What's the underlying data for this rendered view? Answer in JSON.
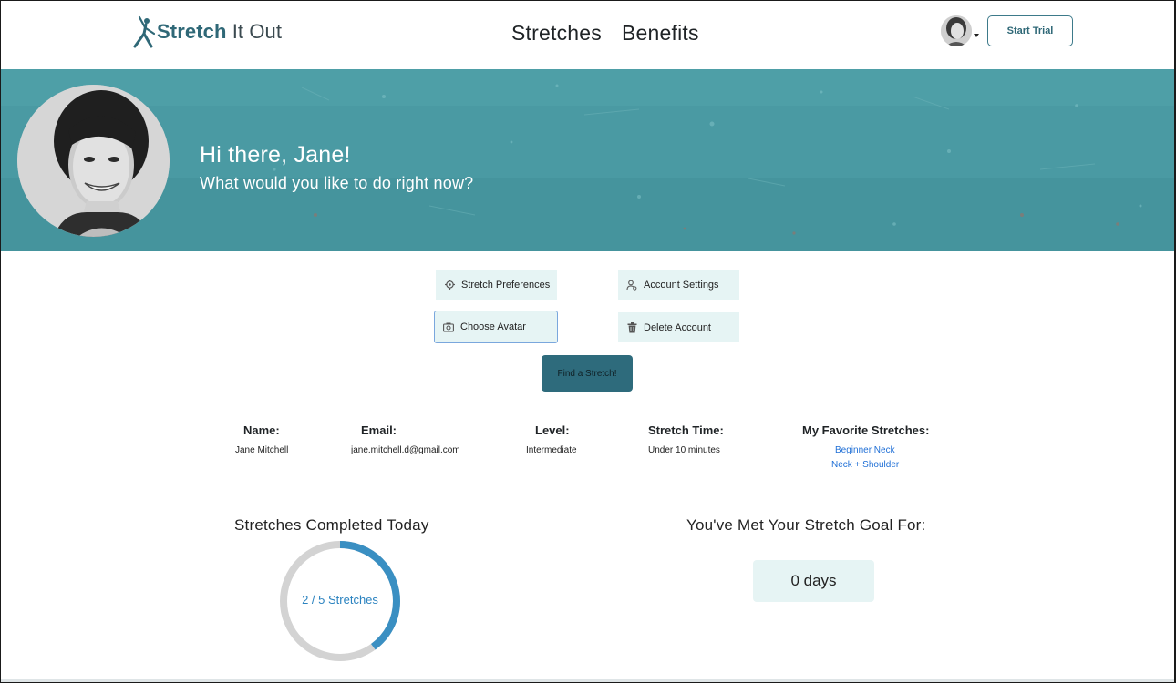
{
  "header": {
    "logo_bold": "Stretch",
    "logo_rest": " It Out",
    "nav": [
      "Stretches",
      "Benefits"
    ],
    "start_trial": "Start Trial"
  },
  "banner": {
    "greeting": "Hi there, Jane!",
    "subtitle": "What would you like to do right now?"
  },
  "actions": {
    "stretch_preferences": "Stretch Preferences",
    "account_settings": "Account Settings",
    "choose_avatar": "Choose Avatar",
    "delete_account": "Delete Account",
    "find_stretch": "Find a Stretch!"
  },
  "profile": {
    "name_label": "Name:",
    "name": "Jane Mitchell",
    "email_label": "Email:",
    "email": "jane.mitchell.d@gmail.com",
    "level_label": "Level:",
    "level": "Intermediate",
    "time_label": "Stretch Time:",
    "time": "Under 10 minutes",
    "favorites_label": "My Favorite Stretches:",
    "favorites": [
      "Beginner Neck",
      "Neck + Shoulder"
    ]
  },
  "stats": {
    "completed_title": "Stretches Completed Today",
    "completed_text": "2 / 5 Stretches",
    "completed_fraction": 0.4,
    "goal_title": "You've Met Your Stretch Goal For:",
    "goal_days": "0 days"
  },
  "colors": {
    "brand": "#2f6877",
    "banner": "#4a9aa3",
    "action_bg": "#e6f4f4",
    "ring_progress": "#3a8fc2",
    "ring_track": "#d3d3d3",
    "link": "#1f6fd6"
  }
}
